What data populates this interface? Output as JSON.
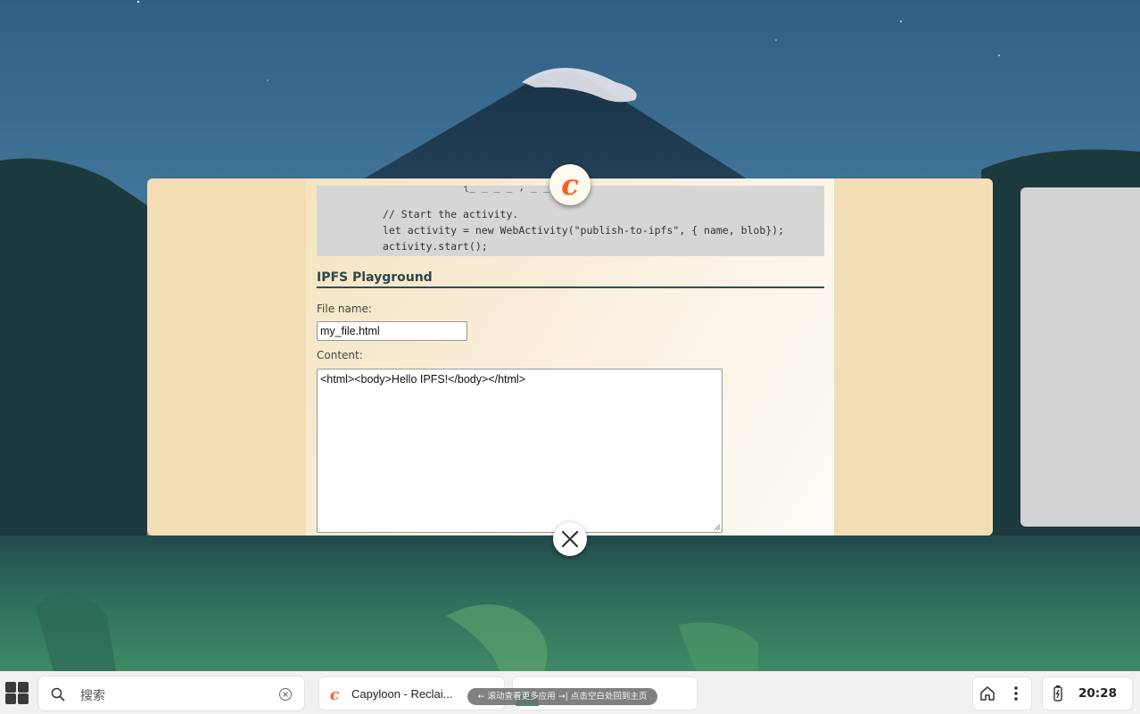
{
  "app_window": {
    "code_lines": [
      "// Start the activity.",
      "let activity = new WebActivity(\"publish-to-ipfs\", { name, blob});",
      "activity.start();"
    ],
    "section_title": "IPFS Playground",
    "file_name_label": "File name:",
    "file_name_value": "my_file.html",
    "content_label": "Content:",
    "content_value": "<html><body>Hello IPFS!</body></html>"
  },
  "taskbar": {
    "search_placeholder": "搜索",
    "tasks": [
      {
        "label": "Capyloon - Reclai...",
        "icon": "capyloon-logo-icon"
      },
      {
        "label": "",
        "icon": "green-app-icon"
      }
    ],
    "hint": "← 滚动查看更多应用 →| 点击空白处回到主页",
    "clock": "20:28"
  },
  "colors": {
    "app_background": "#f3ddb4",
    "code_background": "#d6d6d6",
    "title_color": "#2c4650",
    "capyloon_orange": "#ff5a1f",
    "taskbar_background": "#f1f1f1"
  }
}
